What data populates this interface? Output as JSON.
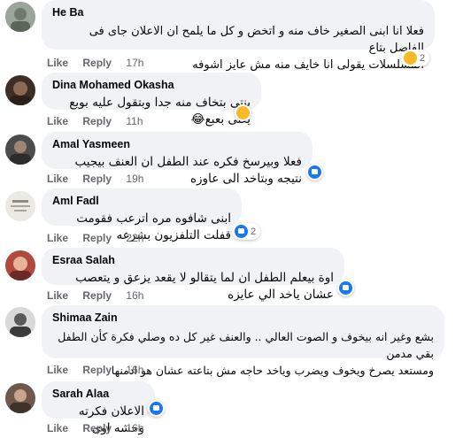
{
  "actions": {
    "like": "Like",
    "reply": "Reply"
  },
  "comments": [
    {
      "name": "He Ba",
      "text_lines": [
        "فعلا انا ابنى الصغير خاف منه و اتخض و كل ما يلمح ان الاعلان جاى فى الفاصل بتاع",
        "المسلسلات يقولى انا خايف منه مش عايز اشوفه"
      ],
      "time": "17h",
      "reaction": {
        "icon": "sad-emoji-icon",
        "count": "2"
      }
    },
    {
      "name": "Dina Mohamed Okasha",
      "text_lines": [
        "بنتى بتخاف منه جدا وبتقول عليه بويع يعنى بعبع😂"
      ],
      "time": "11h",
      "reaction": {
        "icon": "haha-emoji-icon",
        "count": ""
      }
    },
    {
      "name": "Amal Yasmeen",
      "text_lines": [
        "فعلا وبيرسخ فكره عند الطفل ان العنف بيجيب نتيجه وبتاخد الى عاوزه"
      ],
      "time": "19h",
      "reaction": {
        "icon": "like-reaction-icon",
        "count": ""
      }
    },
    {
      "name": "Aml Fadl",
      "text_lines": [
        "ابنى شافوه مره اترعب فقومت قفلت التلفزيون بشرعه"
      ],
      "time": "22h",
      "reaction": {
        "icon": "like-reaction-icon",
        "count": "2"
      }
    },
    {
      "name": "Esraa Salah",
      "text_lines": [
        "اوة بيعلم الطفل ان لما يتقالو لا يقعد يزعق و يتعصب عشان ياخد الي عايزه"
      ],
      "time": "16h",
      "reaction": {
        "icon": "like-reaction-icon",
        "count": ""
      }
    },
    {
      "name": "Shimaa Zain",
      "text_lines": [
        "بشع وغير انه بيخوف و الصوت العالي .. والعنف غير كل ده وصلي فكرة كأن الطفل بقي مدمن",
        "ومستعد يصرخ ويخوف ويضرب وياخد حاجه مش بتاعته عشان هو ادمنها"
      ],
      "time": "16h",
      "reaction": {
        "icon": "",
        "count": ""
      }
    },
    {
      "name": "Sarah Alaa",
      "text_lines": [
        "الاعلان فكرته وحشه اوى"
      ],
      "time": "16h",
      "reaction": {
        "icon": "like-reaction-icon",
        "count": ""
      }
    }
  ]
}
